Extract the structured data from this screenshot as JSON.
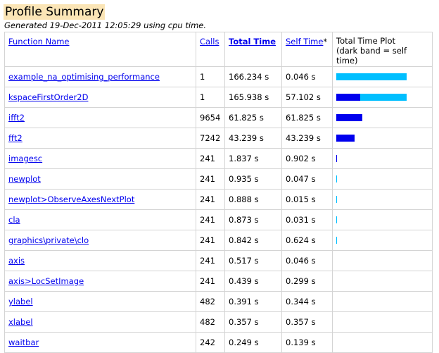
{
  "page": {
    "title": "Profile Summary",
    "subtitle": "Generated 19-Dec-2011 12:05:29 using cpu time."
  },
  "columns": {
    "function_name": "Function Name",
    "calls": "Calls",
    "total_time": "Total Time",
    "self_time": "Self Time",
    "self_time_mark": "*",
    "plot_line1": "Total Time Plot",
    "plot_line2": "(dark band = self time)"
  },
  "colors": {
    "title_bg": "#fbe5b6",
    "link": "#0000ee",
    "total_bar": "#00bfff",
    "self_bar": "#0000ee",
    "grid": "#d4d4d4"
  },
  "plot_max_time": 166.234,
  "rows": [
    {
      "name": "example_na_optimising_performance",
      "calls": "1",
      "total": "166.234 s",
      "self": "0.046 s",
      "total_value": 166.234,
      "self_value": 0.046
    },
    {
      "name": "kspaceFirstOrder2D",
      "calls": "1",
      "total": "165.938 s",
      "self": "57.102 s",
      "total_value": 165.938,
      "self_value": 57.102
    },
    {
      "name": "ifft2",
      "calls": "9654",
      "total": "61.825 s",
      "self": "61.825 s",
      "total_value": 61.825,
      "self_value": 61.825
    },
    {
      "name": "fft2",
      "calls": "7242",
      "total": "43.239 s",
      "self": "43.239 s",
      "total_value": 43.239,
      "self_value": 43.239
    },
    {
      "name": "imagesc",
      "calls": "241",
      "total": "1.837 s",
      "self": "0.902 s",
      "total_value": 1.837,
      "self_value": 0.902
    },
    {
      "name": "newplot",
      "calls": "241",
      "total": "0.935 s",
      "self": "0.047 s",
      "total_value": 0.935,
      "self_value": 0.047
    },
    {
      "name": "newplot>ObserveAxesNextPlot",
      "calls": "241",
      "total": "0.888 s",
      "self": "0.015 s",
      "total_value": 0.888,
      "self_value": 0.015
    },
    {
      "name": "cla",
      "calls": "241",
      "total": "0.873 s",
      "self": "0.031 s",
      "total_value": 0.873,
      "self_value": 0.031
    },
    {
      "name": "graphics\\private\\clo",
      "calls": "241",
      "total": "0.842 s",
      "self": "0.624 s",
      "total_value": 0.842,
      "self_value": 0.624
    },
    {
      "name": "axis",
      "calls": "241",
      "total": "0.517 s",
      "self": "0.046 s",
      "total_value": 0.517,
      "self_value": 0.046
    },
    {
      "name": "axis>LocSetImage",
      "calls": "241",
      "total": "0.439 s",
      "self": "0.299 s",
      "total_value": 0.439,
      "self_value": 0.299
    },
    {
      "name": "ylabel",
      "calls": "482",
      "total": "0.391 s",
      "self": "0.344 s",
      "total_value": 0.391,
      "self_value": 0.344
    },
    {
      "name": "xlabel",
      "calls": "482",
      "total": "0.357 s",
      "self": "0.357 s",
      "total_value": 0.357,
      "self_value": 0.357
    },
    {
      "name": "waitbar",
      "calls": "242",
      "total": "0.249 s",
      "self": "0.139 s",
      "total_value": 0.249,
      "self_value": 0.139
    }
  ]
}
